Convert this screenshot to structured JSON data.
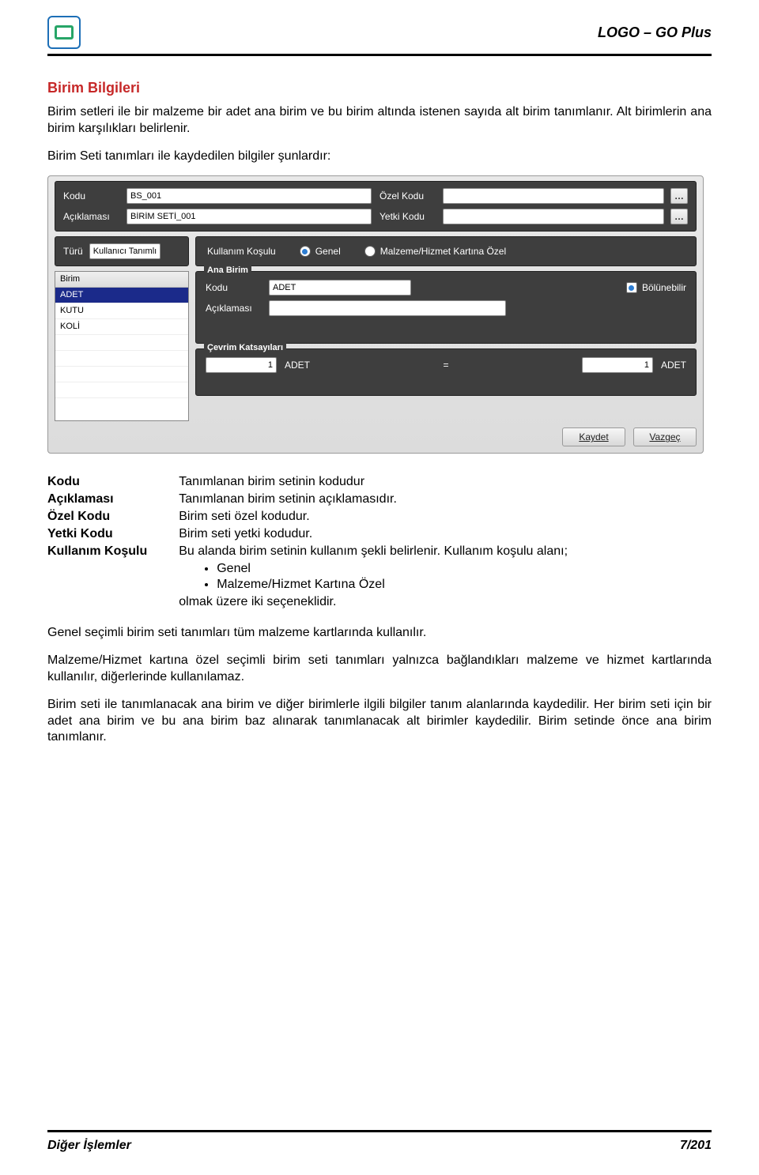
{
  "header": {
    "product": "LOGO – GO Plus"
  },
  "section": {
    "title": "Birim Bilgileri",
    "intro": "Birim setleri ile bir malzeme bir adet ana birim ve bu birim altında istenen sayıda alt birim tanımlanır. Alt birimlerin ana birim karşılıkları belirlenir.",
    "lead": "Birim Seti tanımları ile kaydedilen bilgiler şunlardır:"
  },
  "window": {
    "kodu_label": "Kodu",
    "kodu_value": "BS_001",
    "aciklama_label": "Açıklaması",
    "aciklama_value": "BİRİM SETİ_001",
    "ozel_kodu_label": "Özel Kodu",
    "ozel_kodu_value": "",
    "yetki_kodu_label": "Yetki Kodu",
    "yetki_kodu_value": "",
    "turu_label": "Türü",
    "turu_value": "Kullanıcı Tanımlı",
    "kosul_label": "Kullanım Koşulu",
    "kosul_opt1": "Genel",
    "kosul_opt2": "Malzeme/Hizmet Kartına Özel",
    "grid_header": "Birim",
    "grid_items": [
      "ADET",
      "KUTU",
      "KOLİ"
    ],
    "ana_birim_legend": "Ana Birim",
    "ana_kodu_label": "Kodu",
    "ana_kodu_value": "ADET",
    "ana_aciklama_label": "Açıklaması",
    "ana_aciklama_value": "",
    "bolunebilir_label": "Bölünebilir",
    "coef_legend": "Çevrim Katsayıları",
    "coef_left": "1",
    "coef_left_unit": "ADET",
    "coef_eq": "=",
    "coef_right": "1",
    "coef_right_unit": "ADET",
    "btn_save": "Kaydet",
    "btn_cancel": "Vazgeç"
  },
  "defs": {
    "kodu_term": "Kodu",
    "kodu_def": "Tanımlanan birim setinin kodudur",
    "acik_term": "Açıklaması",
    "acik_def": "Tanımlanan birim setinin açıklamasıdır.",
    "ozel_term": "Özel Kodu",
    "ozel_def": "Birim seti özel kodudur.",
    "yetki_term": "Yetki Kodu",
    "yetki_def": "Birim seti yetki kodudur.",
    "kosul_term": "Kullanım Koşulu",
    "kosul_def_lead": "Bu alanda birim setinin kullanım şekli belirlenir. Kullanım koşulu alanı;",
    "kosul_b1": "Genel",
    "kosul_b2": "Malzeme/Hizmet Kartına Özel",
    "kosul_def_trail": "olmak üzere iki seçeneklidir."
  },
  "paras": {
    "p1": "Genel seçimli birim seti tanımları tüm malzeme kartlarında kullanılır.",
    "p2": "Malzeme/Hizmet kartına özel seçimli birim seti tanımları yalnızca bağlandıkları malzeme ve hizmet kartlarında kullanılır, diğerlerinde kullanılamaz.",
    "p3": "Birim seti ile tanımlanacak ana birim ve diğer birimlerle ilgili bilgiler tanım alanlarında kaydedilir. Her birim seti için bir adet ana birim ve bu ana birim baz alınarak tanımlanacak alt birimler kaydedilir. Birim setinde önce ana birim tanımlanır."
  },
  "footer": {
    "left": "Diğer İşlemler",
    "right": "7/201"
  }
}
